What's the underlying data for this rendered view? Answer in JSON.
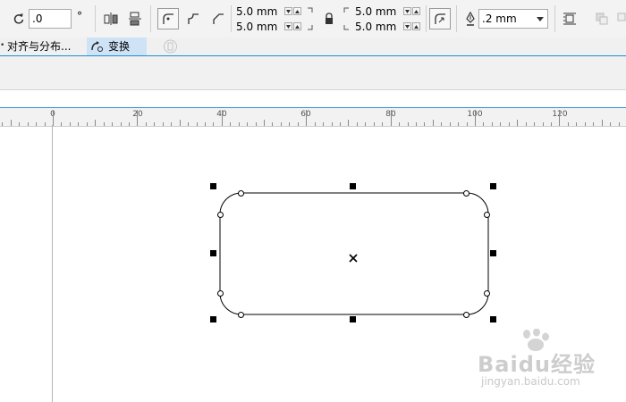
{
  "toolbar": {
    "rotation_value": ".0",
    "rotation_unit": "°",
    "corner_top_left": "5.0 mm",
    "corner_bottom_left": "5.0 mm",
    "corner_top_right": "5.0 mm",
    "corner_bottom_right": "5.0 mm",
    "outline_width": ".2 mm"
  },
  "dockers": {
    "tabs": [
      {
        "label": "对齐与分布...",
        "active": false
      },
      {
        "label": "变换",
        "active": true
      }
    ]
  },
  "ruler": {
    "labels": [
      "0",
      "20",
      "40",
      "60",
      "80",
      "100",
      "120"
    ]
  },
  "watermark": {
    "logo_text": "Baidu经验",
    "url": "jingyan.baidu.com"
  },
  "colors": {
    "accent": "#1c8bd4",
    "active_tab": "#cfe3f7"
  }
}
